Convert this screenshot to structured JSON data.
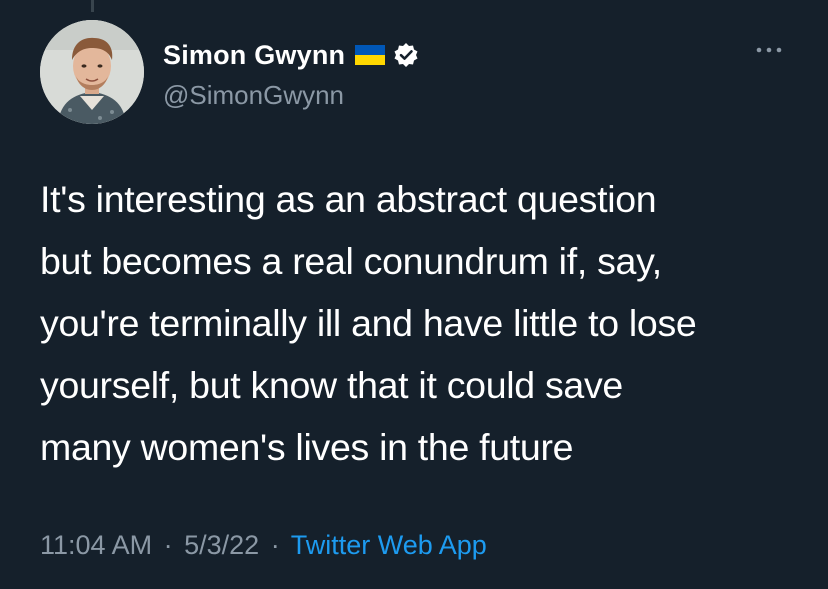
{
  "tweet": {
    "author": {
      "display_name": "Simon Gwynn",
      "handle": "@SimonGwynn",
      "flag_icon": "ukraine-flag-icon",
      "verified_icon": "verified-badge-icon",
      "flag_colors": {
        "top": "#0057b7",
        "bottom": "#ffd700"
      }
    },
    "text": "It's interesting as an abstract question\nbut becomes a real conundrum if, say,\nyou're terminally ill and have little to lose\nyourself, but know that it could save\nmany women's lives in the future",
    "time": "11:04 AM",
    "date": "5/3/22",
    "separator": "·",
    "source": "Twitter Web App",
    "more_icon": "more-options-icon"
  },
  "theme": {
    "background": "#15202b",
    "text": "#ffffff",
    "secondary_text": "#8b98a5",
    "link": "#1d9bf0"
  }
}
